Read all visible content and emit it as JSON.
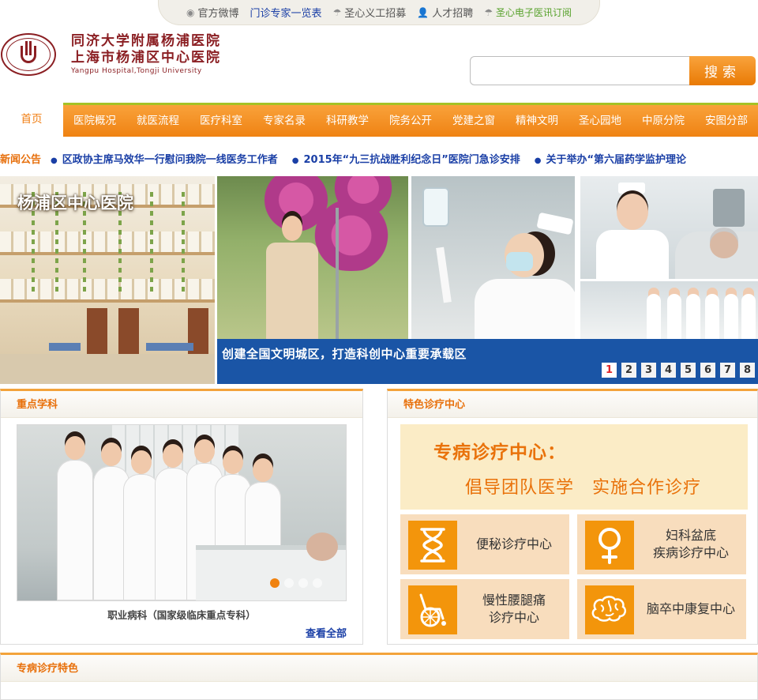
{
  "toplinks": [
    {
      "icon": "weibo-icon",
      "label": "官方微博",
      "style": "normal"
    },
    {
      "icon": "",
      "label": "门诊专家一览表",
      "style": "blue"
    },
    {
      "icon": "umbrella-icon",
      "label": "圣心义工招募",
      "style": "normal"
    },
    {
      "icon": "person-icon",
      "label": "人才招聘",
      "style": "normal"
    },
    {
      "icon": "umbrella-icon",
      "label": "圣心电子医讯订阅",
      "style": "green"
    }
  ],
  "logo": {
    "name_line1": "同济大学附属杨浦医院",
    "name_line2": "上海市杨浦区中心医院",
    "name_en": "Yangpu Hospital,Tongji University",
    "seal_text": "同济大学附属杨浦医院"
  },
  "search": {
    "placeholder": "",
    "value": "",
    "button": "搜索"
  },
  "nav": [
    "首页",
    "医院概况",
    "就医流程",
    "医疗科室",
    "专家名录",
    "科研教学",
    "院务公开",
    "党建之窗",
    "精神文明",
    "圣心园地",
    "中原分院",
    "安图分部"
  ],
  "news": {
    "label": "新闻公告",
    "items": [
      "区政协主席马效华一行慰问我院一线医务工作者",
      "2015年“九三抗战胜利纪念日”医院门急诊安排",
      "关于举办“第六届药学监护理论"
    ]
  },
  "hero": {
    "photo_caption": "杨浦区中心医院",
    "slide_caption": "创建全国文明城区，打造科创中心重要承载区",
    "pages": [
      "1",
      "2",
      "3",
      "4",
      "5",
      "6",
      "7",
      "8"
    ],
    "current_page": 1
  },
  "key_disciplines": {
    "title": "重点学科",
    "caption": "职业病科（国家级临床重点专科）",
    "more": "查看全部",
    "slide_count": 4,
    "slide_current": 1
  },
  "special_centers": {
    "title": "特色诊疗中心",
    "banner_line1": "专病诊疗中心：",
    "banner_line2": "倡导团队医学　实施合作诊疗",
    "cards": [
      {
        "icon": "hourglass-icon",
        "label": "便秘诊疗中心"
      },
      {
        "icon": "female-symbol-icon",
        "label": "妇科盆底\n疾病诊疗中心"
      },
      {
        "icon": "wheelchair-icon",
        "label": "慢性腰腿痛\n诊疗中心"
      },
      {
        "icon": "brain-icon",
        "label": "脑卒中康复中心"
      }
    ]
  },
  "featured": {
    "title": "专病诊疗特色"
  },
  "colors": {
    "accent": "#f08a16",
    "nav_top": "#a5c226",
    "blue": "#1a55a6",
    "link_blue": "#1a3fa6"
  }
}
